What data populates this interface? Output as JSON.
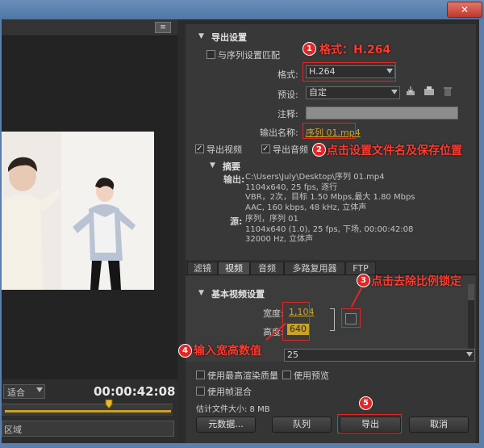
{
  "window": {
    "close_label": "✕"
  },
  "left": {
    "menu_icon": "panel-menu-icon",
    "fit_value": "适合",
    "timecode": "00:00:42:08",
    "region_value": "区域"
  },
  "export_settings": {
    "section_title": "导出设置",
    "match_sequence_label": "与序列设置匹配",
    "format_label": "格式:",
    "format_value": "H.264",
    "preset_label": "预设:",
    "preset_value": "自定",
    "comment_label": "注释:",
    "output_name_label": "输出名称:",
    "output_name_value": "序列 01.mp4",
    "export_video_label": "导出视频",
    "export_audio_label": "导出音频"
  },
  "summary": {
    "title": "摘要",
    "output_label": "输出:",
    "output_lines": [
      "C:\\Users\\July\\Desktop\\序列 01.mp4",
      "1104x640, 25 fps, 逐行",
      "VBR，2次，目标 1.50 Mbps,最大 1.80 Mbps",
      "AAC, 160 kbps, 48 kHz, 立体声"
    ],
    "source_label": "源:",
    "source_lines": [
      "序列，序列 01",
      "1104x640 (1.0), 25 fps, 下场, 00:00:42:08",
      "32000 Hz, 立体声"
    ]
  },
  "tabs": [
    "滤镜",
    "视频",
    "音频",
    "多路复用器",
    "FTP"
  ],
  "video": {
    "section_title": "基本视频设置",
    "width_label": "宽度:",
    "width_value": "1,104",
    "height_label": "高度:",
    "height_value": "640",
    "framerate_value": "25"
  },
  "bottom": {
    "max_render_label": "使用最高渲染质量",
    "use_preview_label": "使用预览",
    "frame_blend_label": "使用帧混合",
    "file_size_label": "估计文件大小: 8 MB",
    "metadata_button": "元数据...",
    "queue_button": "队列",
    "export_button": "导出",
    "cancel_button": "取消"
  },
  "annotations": {
    "a1_num": "1",
    "a1_text": "格式：H.264",
    "a2_num": "2",
    "a2_text": "点击设置文件名及保存位置",
    "a3_num": "3",
    "a3_text": "点击去除比例锁定",
    "a4_num": "4",
    "a4_text": "输入宽高数值",
    "a5_num": "5"
  },
  "colors": {
    "accent_red": "#e32626",
    "link_gold": "#d6a526"
  }
}
